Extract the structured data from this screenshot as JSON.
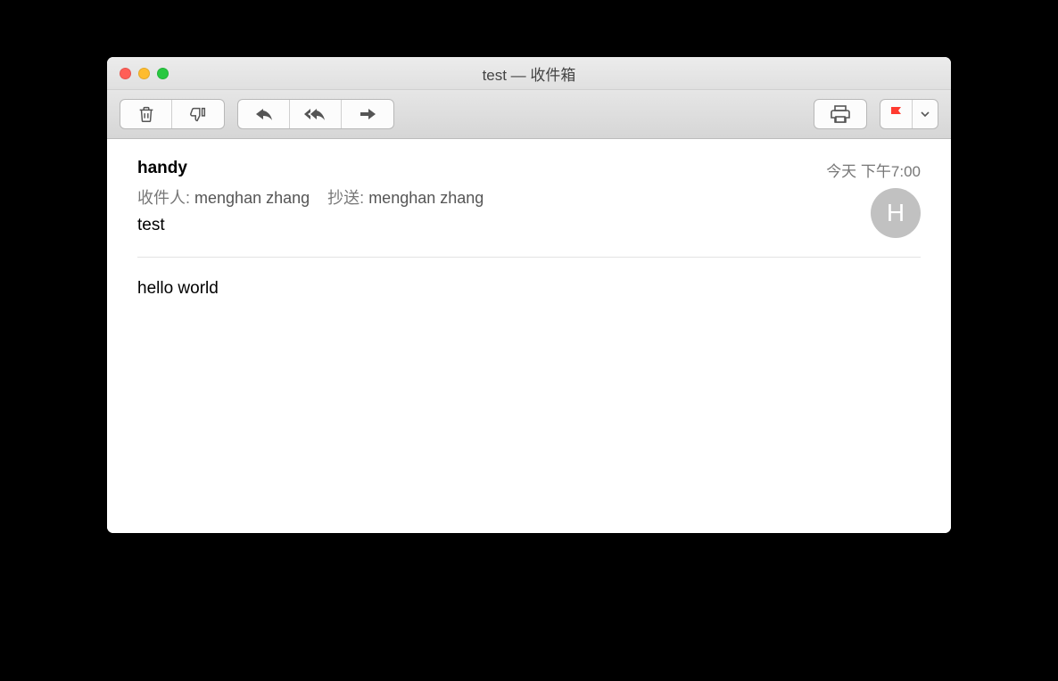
{
  "window_title": "test — 收件箱",
  "toolbar": {
    "delete_icon": "trash-icon",
    "junk_icon": "thumbs-down-icon",
    "reply_icon": "reply-icon",
    "reply_all_icon": "reply-all-icon",
    "forward_icon": "forward-icon",
    "print_icon": "print-icon",
    "flag_icon": "flag-icon",
    "flag_dropdown_icon": "chevron-down-icon"
  },
  "message": {
    "sender": "handy",
    "timestamp": "今天 下午7:00",
    "to_label": "收件人:",
    "to_value": "menghan zhang",
    "cc_label": "抄送:",
    "cc_value": "menghan zhang",
    "subject": "test",
    "avatar_initial": "H",
    "body": "hello world"
  }
}
